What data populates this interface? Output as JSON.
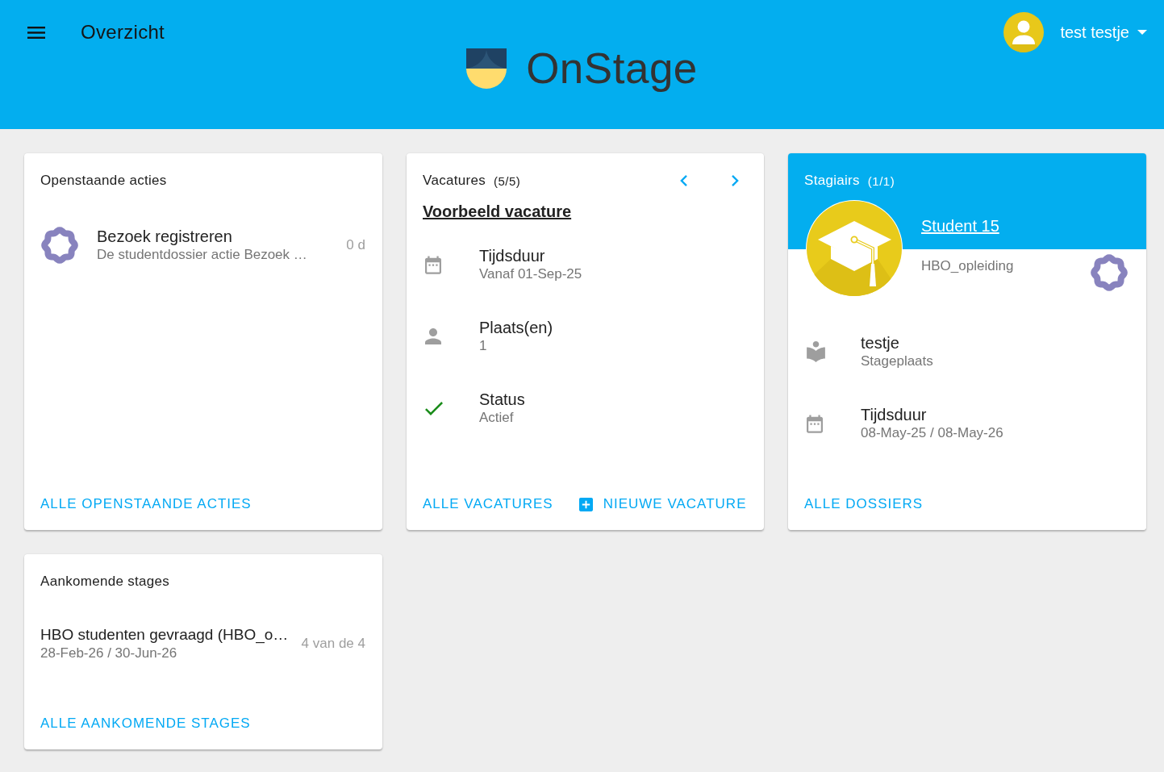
{
  "app_bar": {
    "title": "Overzicht",
    "logo": {
      "text": "OnStage"
    },
    "user": {
      "name": "test testje"
    }
  },
  "cards": [
    {
      "kind": "actions",
      "title": "Openstaande acties",
      "items": [
        {
          "title": "Bezoek registreren",
          "subtitle": "De studentdossier actie Bezoek …",
          "trailing": "0 d"
        }
      ],
      "actions": [
        {
          "kind": "link",
          "label": "ALLE OPENSTAANDE ACTIES"
        }
      ]
    },
    {
      "kind": "vacancies",
      "title": "Vacatures",
      "count": "(5/5)",
      "vacancy": "Voorbeeld vacature",
      "details": [
        {
          "kind": "period",
          "label": "Tijdsduur",
          "value": "Vanaf 01-Sep-25"
        },
        {
          "kind": "places",
          "label": "Plaats(en)",
          "value": "1"
        },
        {
          "kind": "status",
          "label": "Status",
          "value": "Actief"
        }
      ],
      "actions": [
        {
          "kind": "link",
          "label": "ALLE VACATURES"
        },
        {
          "kind": "create",
          "label": "NIEUWE VACATURE"
        }
      ]
    },
    {
      "kind": "interns",
      "title": "Stagiairs",
      "count": "(1/1)",
      "student": {
        "name": "Student 15",
        "education": "HBO_opleiding"
      },
      "details": [
        {
          "kind": "workplace",
          "label": "testje",
          "value": "Stageplaats"
        },
        {
          "kind": "period",
          "label": "Tijdsduur",
          "value": "08-May-25 / 08-May-26"
        }
      ],
      "actions": [
        {
          "kind": "link",
          "label": "ALLE DOSSIERS"
        }
      ]
    },
    {
      "kind": "upcoming",
      "title": "Aankomende stages",
      "items": [
        {
          "title": "HBO studenten gevraagd (HBO_o…",
          "subtitle": "28-Feb-26 / 30-Jun-26",
          "trailing": "4 van de 4"
        }
      ],
      "actions": [
        {
          "kind": "link",
          "label": "ALLE AANKOMENDE STAGES"
        }
      ]
    }
  ]
}
